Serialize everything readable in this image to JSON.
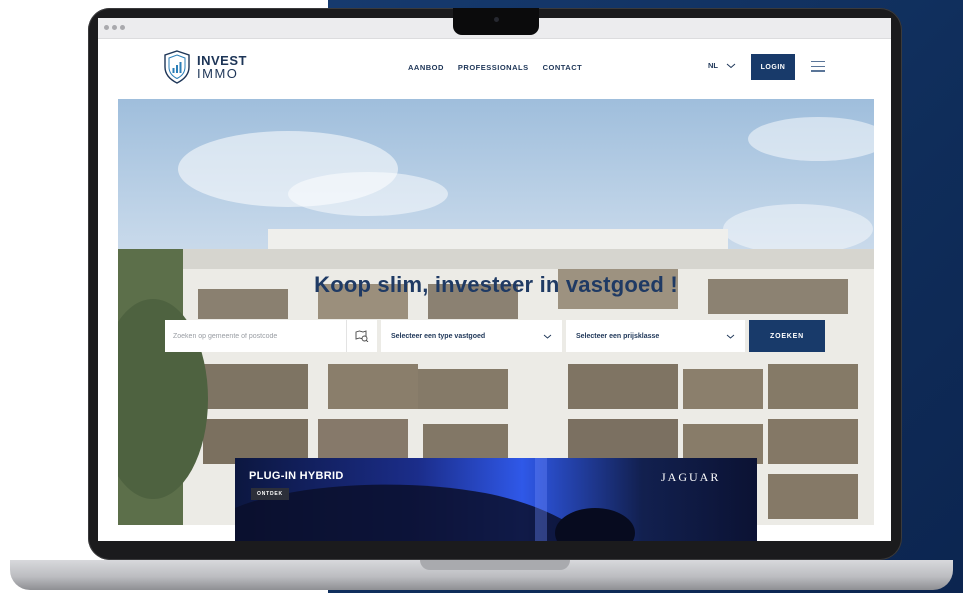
{
  "site": {
    "logo": {
      "line1": "INVEST",
      "line2": "IMMO"
    },
    "nav": [
      "AANBOD",
      "PROFESSIONALS",
      "CONTACT"
    ],
    "language": "NL",
    "login_label": "LOGIN"
  },
  "hero": {
    "title": "Koop slim, investeer in vastgoed !",
    "search": {
      "placeholder": "Zoeken op gemeente of postcode",
      "type_select": "Selecteer een type vastgoed",
      "price_select": "Selecteer een prijsklasse",
      "button": "ZOEKEN"
    }
  },
  "ad": {
    "title": "PLUG-IN HYBRID",
    "button": "ONTDEK",
    "brand": "JAGUAR"
  },
  "colors": {
    "brand_navy": "#183a6a",
    "backdrop": "#0f2d5a",
    "title_blue": "#1f3a64"
  }
}
